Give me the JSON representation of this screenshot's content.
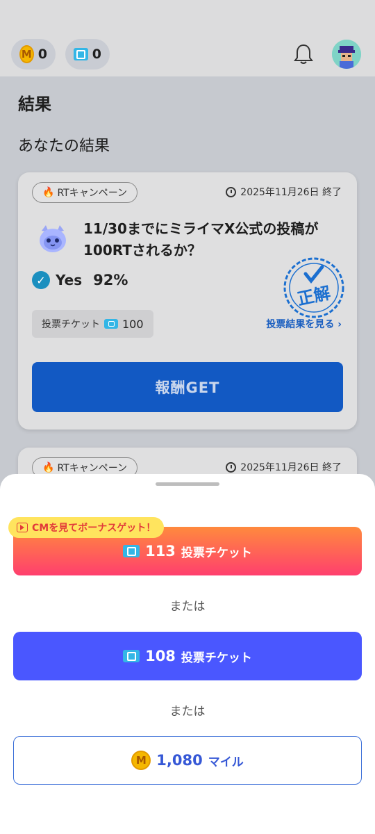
{
  "header": {
    "miles_count": "0",
    "tickets_count": "0",
    "coin_letter": "M"
  },
  "page": {
    "title": "結果",
    "subtitle": "あなたの結果"
  },
  "cards": [
    {
      "campaign": "RTキャンペーン",
      "deadline": "2025年11月26日 終了",
      "question": "11/30までにミライマX公式の投稿が100RTされるか？",
      "answer": "Yes",
      "percent": "92%",
      "stamp_text": "正解",
      "vote_label": "投票チケット",
      "vote_count": "100",
      "result_link": "投票結果を見る ›",
      "reward_button": "報酬GET"
    },
    {
      "campaign": "RTキャンペーン",
      "deadline": "2025年11月26日 終了"
    }
  ],
  "sheet": {
    "bonus_badge": "CMを見てボーナスゲット！",
    "option_cm": {
      "amount": "113",
      "unit": "投票チケット"
    },
    "or_text": "または",
    "option_ticket": {
      "amount": "108",
      "unit": "投票チケット"
    },
    "option_mile": {
      "amount": "1,080",
      "unit": "マイル"
    }
  },
  "colors": {
    "primary_button": "#1259c3",
    "ticket_option": "#4a57ff",
    "cm_gradient_top": "#ff8a3d",
    "cm_gradient_bottom": "#ff3f6e",
    "bonus_badge": "#ffe45e",
    "stamp_blue": "#1b6fd0"
  },
  "icons": [
    "coin-icon",
    "ticket-icon",
    "bell-icon",
    "avatar",
    "flame-icon",
    "clock-icon",
    "mascot-icon",
    "check-icon",
    "correct-stamp",
    "play-icon"
  ]
}
